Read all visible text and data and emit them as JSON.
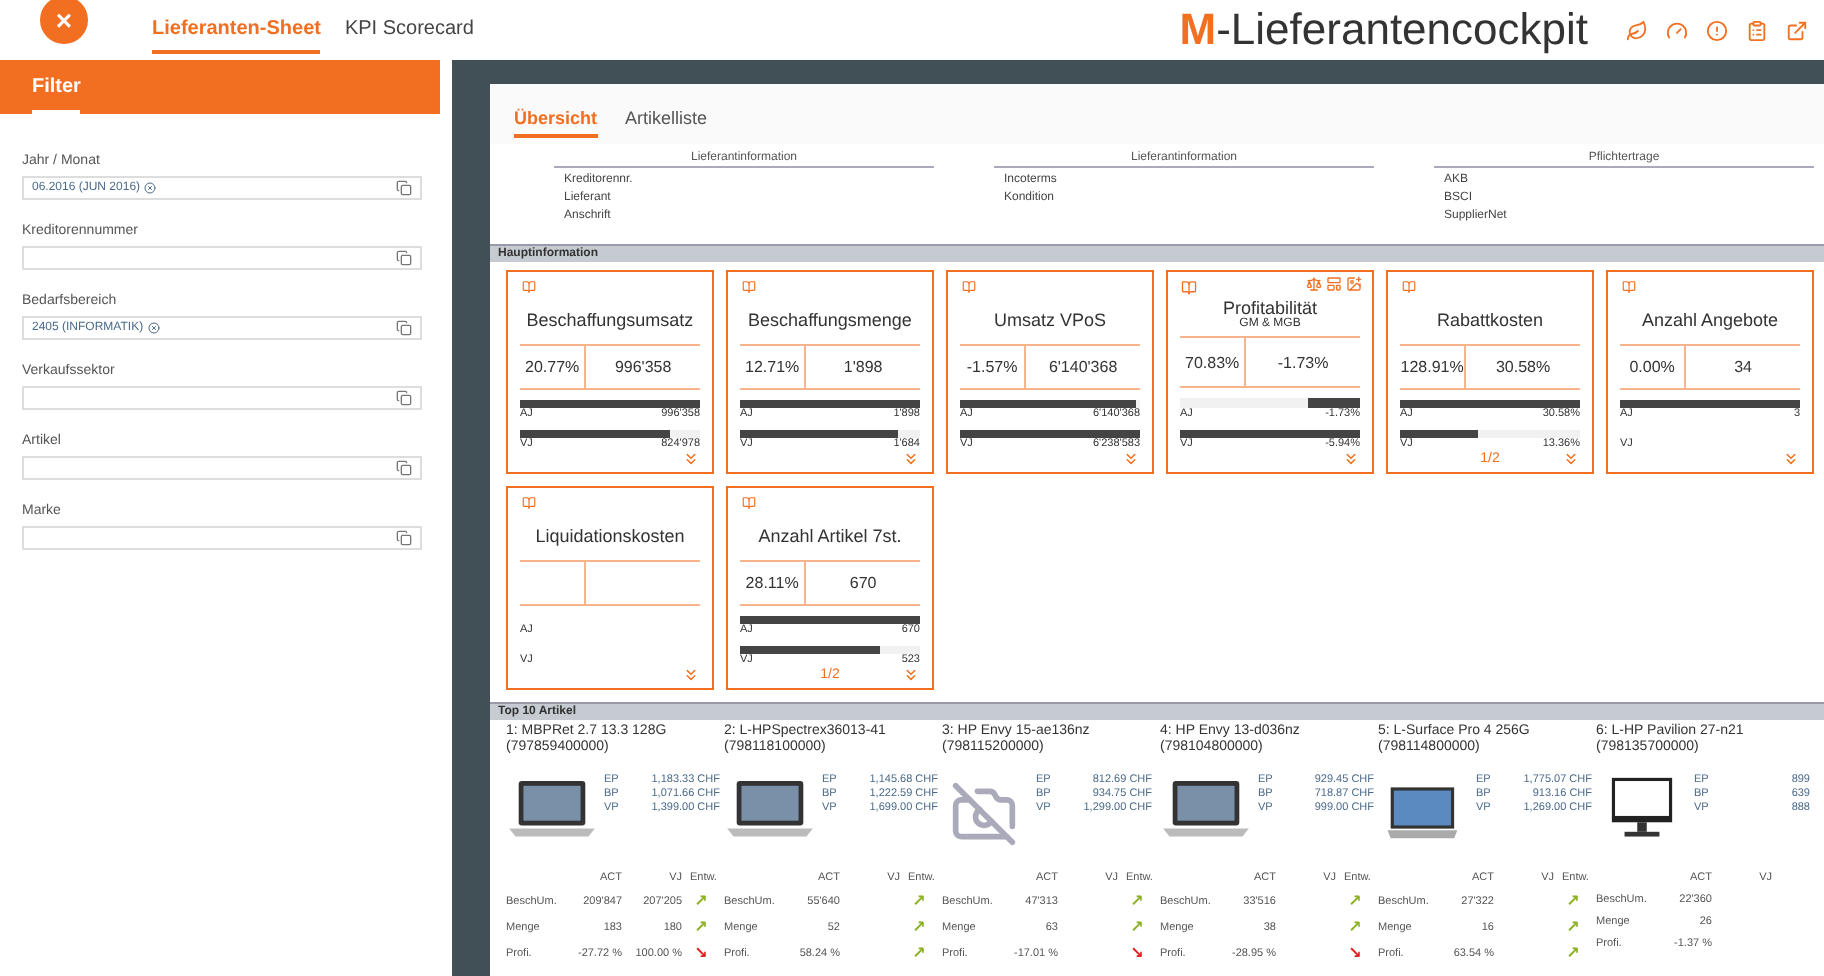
{
  "topbar": {
    "close": "×",
    "tabs": [
      {
        "label": "Lieferanten-Sheet",
        "selected": true
      },
      {
        "label": "KPI Scorecard",
        "selected": false
      }
    ],
    "logo": {
      "mark": "M",
      "text": "-Lieferantencockpit"
    }
  },
  "filter": {
    "title": "Filter",
    "fields": [
      {
        "label": "Jahr / Monat",
        "chip": "06.2016 (JUN 2016)"
      },
      {
        "label": "Kreditorennummer"
      },
      {
        "label": "Bedarfsbereich",
        "chip": "2405 (INFORMATIK)"
      },
      {
        "label": "Verkaufssektor"
      },
      {
        "label": "Artikel"
      },
      {
        "label": "Marke"
      }
    ]
  },
  "content_tabs": [
    {
      "label": "Übersicht",
      "selected": true
    },
    {
      "label": "Artikelliste",
      "selected": false
    }
  ],
  "info_columns": [
    {
      "heading": "Lieferantinformation",
      "items": [
        "Kreditorennr.",
        "Lieferant",
        "Anschrift"
      ]
    },
    {
      "heading": "Lieferantinformation",
      "items": [
        "Incoterms",
        "Kondition"
      ]
    },
    {
      "heading": "Pflichtertrage",
      "items": [
        "AKB",
        "BSCI",
        "SupplierNet"
      ]
    }
  ],
  "main_section": "Hauptinformation",
  "kpi_cards": [
    {
      "kind": "amount",
      "title": "Beschaffungsumsatz",
      "pct": "20.77%",
      "value": "996'358",
      "bars": [
        {
          "label": "AJ",
          "level": 1,
          "value": "996'358"
        },
        {
          "label": "VJ",
          "level": 0.83,
          "value": "824'978"
        }
      ]
    },
    {
      "kind": "amount",
      "title": "Beschaffungsmenge",
      "pct": "12.71%",
      "value": "1'898",
      "bars": [
        {
          "label": "AJ",
          "level": 1,
          "value": "1'898"
        },
        {
          "label": "VJ",
          "level": 0.88,
          "value": "1'684"
        }
      ]
    },
    {
      "kind": "amount",
      "title": "Umsatz VPoS",
      "pct": "-1.57%",
      "value": "6'140'368",
      "bars": [
        {
          "label": "AJ",
          "level": 0.98,
          "value": "6'140'368"
        },
        {
          "label": "VJ",
          "level": 1,
          "value": "6'238'583"
        }
      ]
    },
    {
      "kind": "ratio",
      "title": "Profitabilität",
      "subtitle": "GM & MGB",
      "pct": "70.83%",
      "value": "-1.73%",
      "bars": [
        {
          "label": "AJ",
          "level": 0.29,
          "value": "-1.73%"
        },
        {
          "label": "VJ",
          "level": 1,
          "value": "-5.94%"
        }
      ]
    },
    {
      "kind": "amount",
      "title": "Rabattkosten",
      "pct": "128.91%",
      "value": "30.58%",
      "bars": [
        {
          "label": "AJ",
          "level": 1,
          "value": "30.58%"
        },
        {
          "label": "VJ",
          "level": 0.43,
          "value": "13.36%"
        }
      ],
      "pager": "1/2"
    },
    {
      "kind": "amount",
      "title": "Anzahl Angebote",
      "pct": "0.00%",
      "value": "34",
      "bars": [
        {
          "label": "AJ",
          "level": 1,
          "value": "3"
        },
        {
          "label": "VJ"
        }
      ]
    },
    {
      "kind": "amount",
      "title": "Liquidationskosten",
      "bars": [
        {
          "label": "AJ"
        },
        {
          "label": "VJ"
        }
      ]
    },
    {
      "kind": "amount",
      "title": "Anzahl Artikel 7st.",
      "pct": "28.11%",
      "value": "670",
      "bars": [
        {
          "label": "AJ",
          "level": 1,
          "value": "670"
        },
        {
          "label": "VJ",
          "level": 0.78,
          "value": "523"
        }
      ],
      "pager": "1/2"
    }
  ],
  "top_section": "Top 10 Artikel",
  "products": [
    {
      "name": "1: MBPRet 2.7 13.3 128G",
      "code": "(797859400000)",
      "kind": "laptop",
      "prices": [
        [
          "EP",
          "1,183.33 CHF"
        ],
        [
          "BP",
          "1,071.66 CHF"
        ],
        [
          "VP",
          "1,399.00 CHF"
        ]
      ],
      "header": [
        "ACT",
        "VJ",
        "Entw."
      ],
      "stats": [
        {
          "label": "BeschUm.",
          "act": "209'847",
          "vj": "207'205",
          "trend": "↗",
          "color": "#8ab020"
        },
        {
          "label": "Menge",
          "act": "183",
          "vj": "180",
          "trend": "↗",
          "color": "#8ab020"
        },
        {
          "label": "Profi.",
          "act": "-27.72 %",
          "vj": "100.00 %",
          "trend": "↘",
          "color": "#e02020"
        }
      ]
    },
    {
      "name": "2: L-HPSpectrex36013-41",
      "code": "(798118100000)",
      "kind": "laptop",
      "prices": [
        [
          "EP",
          "1,145.68 CHF"
        ],
        [
          "BP",
          "1,222.59 CHF"
        ],
        [
          "VP",
          "1,699.00 CHF"
        ]
      ],
      "header": [
        "ACT",
        "VJ",
        "Entw."
      ],
      "stats": [
        {
          "label": "BeschUm.",
          "act": "55'640",
          "trend": "↗",
          "color": "#8ab020"
        },
        {
          "label": "Menge",
          "act": "52",
          "trend": "↗",
          "color": "#8ab020"
        },
        {
          "label": "Profi.",
          "act": "58.24 %",
          "trend": "↗",
          "color": "#8ab020"
        }
      ]
    },
    {
      "name": "3: HP Envy 15-ae136nz",
      "code": "(798115200000)",
      "kind": "no-photo",
      "prices": [
        [
          "EP",
          "812.69 CHF"
        ],
        [
          "BP",
          "934.75 CHF"
        ],
        [
          "VP",
          "1,299.00 CHF"
        ]
      ],
      "header": [
        "ACT",
        "VJ",
        "Entw."
      ],
      "stats": [
        {
          "label": "BeschUm.",
          "act": "47'313",
          "trend": "↗",
          "color": "#8ab020"
        },
        {
          "label": "Menge",
          "act": "63",
          "trend": "↗",
          "color": "#8ab020"
        },
        {
          "label": "Profi.",
          "act": "-17.01 %",
          "trend": "↘",
          "color": "#e02020"
        }
      ]
    },
    {
      "name": "4: HP Envy 13-d036nz (798104800000)",
      "kind": "laptop",
      "prices": [
        [
          "EP",
          "929.45 CHF"
        ],
        [
          "BP",
          "718.87 CHF"
        ],
        [
          "VP",
          "999.00 CHF"
        ]
      ],
      "header": [
        "ACT",
        "VJ",
        "Entw."
      ],
      "stats": [
        {
          "label": "BeschUm.",
          "act": "33'516",
          "trend": "↗",
          "color": "#8ab020"
        },
        {
          "label": "Menge",
          "act": "38",
          "trend": "↗",
          "color": "#8ab020"
        },
        {
          "label": "Profi.",
          "act": "-28.95 %",
          "trend": "↘",
          "color": "#e02020"
        }
      ]
    },
    {
      "name": "5: L-Surface Pro 4 256G",
      "code": "(798114800000)",
      "kind": "tablet",
      "prices": [
        [
          "EP",
          "1,775.07 CHF"
        ],
        [
          "BP",
          "913.16 CHF"
        ],
        [
          "VP",
          "1,269.00 CHF"
        ]
      ],
      "header": [
        "ACT",
        "VJ",
        "Entw."
      ],
      "stats": [
        {
          "label": "BeschUm.",
          "act": "27'322",
          "trend": "↗",
          "color": "#8ab020"
        },
        {
          "label": "Menge",
          "act": "16",
          "trend": "↗",
          "color": "#8ab020"
        },
        {
          "label": "Profi.",
          "act": "63.54 %",
          "trend": "↗",
          "color": "#8ab020"
        }
      ]
    },
    {
      "name": "6: L-HP Pavilion 27-n21",
      "code": "(798135700000)",
      "kind": "monitor",
      "prices": [
        [
          "EP",
          "899"
        ],
        [
          "BP",
          "639"
        ],
        [
          "VP",
          "888"
        ]
      ],
      "header": [
        "ACT",
        "VJ"
      ],
      "stats": [
        {
          "label": "BeschUm.",
          "act": "22'360"
        },
        {
          "label": "Menge",
          "act": "26"
        },
        {
          "label": "Profi.",
          "act": "-1.37 %"
        }
      ]
    }
  ]
}
